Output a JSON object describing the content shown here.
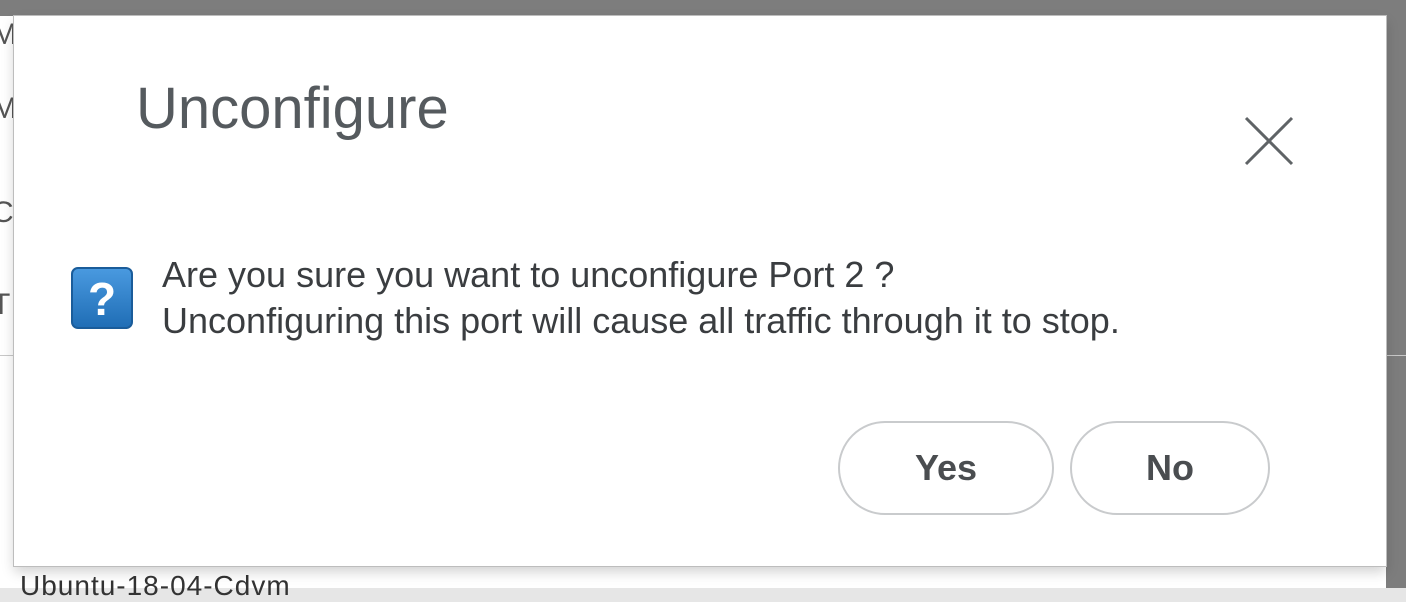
{
  "dialog": {
    "title": "Unconfigure",
    "message_line1": "Are you sure you want to unconfigure Port 2 ?",
    "message_line2": "Unconfiguring this port will cause all traffic through it to stop.",
    "question_icon": "question-icon",
    "close_icon": "close-icon",
    "yes_label": "Yes",
    "no_label": "No"
  },
  "background": {
    "partial_letters": [
      "M",
      "M",
      "C",
      "T"
    ],
    "partial_bottom_text": "Ubuntu-18-04-Cdvm"
  },
  "colors": {
    "icon_blue": "#2f7fc6",
    "title_gray": "#555a5e",
    "button_border": "#c9cbcd"
  }
}
